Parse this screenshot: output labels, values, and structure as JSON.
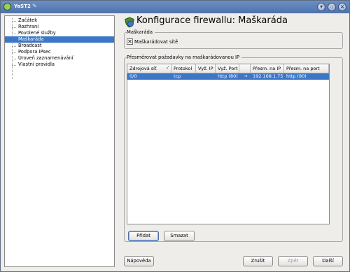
{
  "window": {
    "title": "YaST2",
    "controls": [
      "chevron-down-icon",
      "window-icon",
      "close-icon"
    ]
  },
  "sidebar": {
    "items": [
      {
        "label": "Začátek",
        "selected": false
      },
      {
        "label": "Rozhraní",
        "selected": false
      },
      {
        "label": "Povolené služby",
        "selected": false
      },
      {
        "label": "Maškaráda",
        "selected": true
      },
      {
        "label": "Broadcast",
        "selected": false
      },
      {
        "label": "Podpora IPsec",
        "selected": false
      },
      {
        "label": "Úroveň zaznamenávání",
        "selected": false
      },
      {
        "label": "Vlastní pravidla",
        "selected": false
      }
    ]
  },
  "main": {
    "heading": "Konfigurace firewallu: Maškaráda",
    "masquerade_group": {
      "title": "Maškaráda",
      "checkbox_label": "Maškarádovat sítě",
      "checked": true
    },
    "redirect_group": {
      "title": "Přesměrovat požadavky na maškarádovanou IP",
      "columns": [
        "Zdrojová síť",
        "Protokol",
        "Vyž. IP",
        "Vyž. Port",
        "",
        "Přesm. na IP",
        "Přesm. na port"
      ],
      "rows": [
        [
          "0/0",
          "tcp",
          "",
          "http (80)",
          "→",
          "192.168.1.75",
          "http (80)"
        ]
      ],
      "add_label": "Přidat",
      "delete_label": "Smazat"
    }
  },
  "footer": {
    "help_label": "Nápověda",
    "cancel_label": "Zrušit",
    "back_label": "Zpět",
    "next_label": "Další"
  },
  "colors": {
    "selection": "#3c76c7",
    "titlebar": "#5a7db6",
    "window_bg": "#eeedea"
  }
}
